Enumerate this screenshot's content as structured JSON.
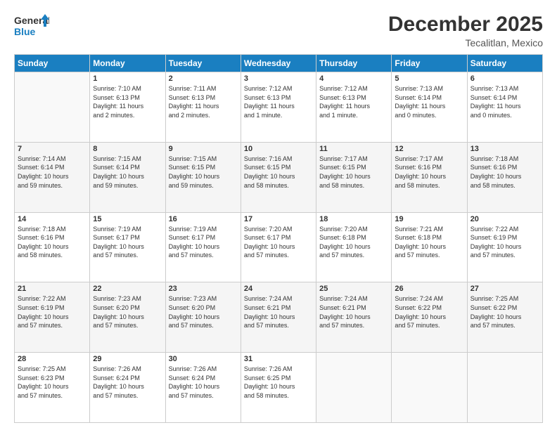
{
  "header": {
    "logo_line1": "General",
    "logo_line2": "Blue",
    "title": "December 2025",
    "subtitle": "Tecalitlan, Mexico"
  },
  "columns": [
    "Sunday",
    "Monday",
    "Tuesday",
    "Wednesday",
    "Thursday",
    "Friday",
    "Saturday"
  ],
  "weeks": [
    [
      {
        "num": "",
        "info": ""
      },
      {
        "num": "1",
        "info": "Sunrise: 7:10 AM\nSunset: 6:13 PM\nDaylight: 11 hours\nand 2 minutes."
      },
      {
        "num": "2",
        "info": "Sunrise: 7:11 AM\nSunset: 6:13 PM\nDaylight: 11 hours\nand 2 minutes."
      },
      {
        "num": "3",
        "info": "Sunrise: 7:12 AM\nSunset: 6:13 PM\nDaylight: 11 hours\nand 1 minute."
      },
      {
        "num": "4",
        "info": "Sunrise: 7:12 AM\nSunset: 6:13 PM\nDaylight: 11 hours\nand 1 minute."
      },
      {
        "num": "5",
        "info": "Sunrise: 7:13 AM\nSunset: 6:14 PM\nDaylight: 11 hours\nand 0 minutes."
      },
      {
        "num": "6",
        "info": "Sunrise: 7:13 AM\nSunset: 6:14 PM\nDaylight: 11 hours\nand 0 minutes."
      }
    ],
    [
      {
        "num": "7",
        "info": "Sunrise: 7:14 AM\nSunset: 6:14 PM\nDaylight: 10 hours\nand 59 minutes."
      },
      {
        "num": "8",
        "info": "Sunrise: 7:15 AM\nSunset: 6:14 PM\nDaylight: 10 hours\nand 59 minutes."
      },
      {
        "num": "9",
        "info": "Sunrise: 7:15 AM\nSunset: 6:15 PM\nDaylight: 10 hours\nand 59 minutes."
      },
      {
        "num": "10",
        "info": "Sunrise: 7:16 AM\nSunset: 6:15 PM\nDaylight: 10 hours\nand 58 minutes."
      },
      {
        "num": "11",
        "info": "Sunrise: 7:17 AM\nSunset: 6:15 PM\nDaylight: 10 hours\nand 58 minutes."
      },
      {
        "num": "12",
        "info": "Sunrise: 7:17 AM\nSunset: 6:16 PM\nDaylight: 10 hours\nand 58 minutes."
      },
      {
        "num": "13",
        "info": "Sunrise: 7:18 AM\nSunset: 6:16 PM\nDaylight: 10 hours\nand 58 minutes."
      }
    ],
    [
      {
        "num": "14",
        "info": "Sunrise: 7:18 AM\nSunset: 6:16 PM\nDaylight: 10 hours\nand 58 minutes."
      },
      {
        "num": "15",
        "info": "Sunrise: 7:19 AM\nSunset: 6:17 PM\nDaylight: 10 hours\nand 57 minutes."
      },
      {
        "num": "16",
        "info": "Sunrise: 7:19 AM\nSunset: 6:17 PM\nDaylight: 10 hours\nand 57 minutes."
      },
      {
        "num": "17",
        "info": "Sunrise: 7:20 AM\nSunset: 6:17 PM\nDaylight: 10 hours\nand 57 minutes."
      },
      {
        "num": "18",
        "info": "Sunrise: 7:20 AM\nSunset: 6:18 PM\nDaylight: 10 hours\nand 57 minutes."
      },
      {
        "num": "19",
        "info": "Sunrise: 7:21 AM\nSunset: 6:18 PM\nDaylight: 10 hours\nand 57 minutes."
      },
      {
        "num": "20",
        "info": "Sunrise: 7:22 AM\nSunset: 6:19 PM\nDaylight: 10 hours\nand 57 minutes."
      }
    ],
    [
      {
        "num": "21",
        "info": "Sunrise: 7:22 AM\nSunset: 6:19 PM\nDaylight: 10 hours\nand 57 minutes."
      },
      {
        "num": "22",
        "info": "Sunrise: 7:23 AM\nSunset: 6:20 PM\nDaylight: 10 hours\nand 57 minutes."
      },
      {
        "num": "23",
        "info": "Sunrise: 7:23 AM\nSunset: 6:20 PM\nDaylight: 10 hours\nand 57 minutes."
      },
      {
        "num": "24",
        "info": "Sunrise: 7:24 AM\nSunset: 6:21 PM\nDaylight: 10 hours\nand 57 minutes."
      },
      {
        "num": "25",
        "info": "Sunrise: 7:24 AM\nSunset: 6:21 PM\nDaylight: 10 hours\nand 57 minutes."
      },
      {
        "num": "26",
        "info": "Sunrise: 7:24 AM\nSunset: 6:22 PM\nDaylight: 10 hours\nand 57 minutes."
      },
      {
        "num": "27",
        "info": "Sunrise: 7:25 AM\nSunset: 6:22 PM\nDaylight: 10 hours\nand 57 minutes."
      }
    ],
    [
      {
        "num": "28",
        "info": "Sunrise: 7:25 AM\nSunset: 6:23 PM\nDaylight: 10 hours\nand 57 minutes."
      },
      {
        "num": "29",
        "info": "Sunrise: 7:26 AM\nSunset: 6:24 PM\nDaylight: 10 hours\nand 57 minutes."
      },
      {
        "num": "30",
        "info": "Sunrise: 7:26 AM\nSunset: 6:24 PM\nDaylight: 10 hours\nand 57 minutes."
      },
      {
        "num": "31",
        "info": "Sunrise: 7:26 AM\nSunset: 6:25 PM\nDaylight: 10 hours\nand 58 minutes."
      },
      {
        "num": "",
        "info": ""
      },
      {
        "num": "",
        "info": ""
      },
      {
        "num": "",
        "info": ""
      }
    ]
  ]
}
